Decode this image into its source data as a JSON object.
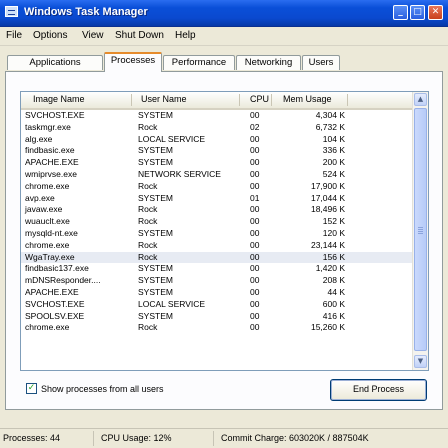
{
  "window": {
    "title": "Windows Task Manager"
  },
  "menu": [
    "File",
    "Options",
    "View",
    "Shut Down",
    "Help"
  ],
  "tabs": [
    {
      "label": "Applications",
      "active": false
    },
    {
      "label": "Processes",
      "active": true
    },
    {
      "label": "Performance",
      "active": false
    },
    {
      "label": "Networking",
      "active": false
    },
    {
      "label": "Users",
      "active": false
    }
  ],
  "columns": [
    "Image Name",
    "User Name",
    "CPU",
    "Mem Usage"
  ],
  "processes": [
    [
      "SVCHOST.EXE",
      "SYSTEM",
      "00",
      "4,304 K"
    ],
    [
      "taskmgr.exe",
      "Rock",
      "02",
      "6,732 K"
    ],
    [
      "alg.exe",
      "LOCAL SERVICE",
      "00",
      "104 K"
    ],
    [
      "findbasic.exe",
      "SYSTEM",
      "00",
      "336 K"
    ],
    [
      "APACHE.EXE",
      "SYSTEM",
      "00",
      "200 K"
    ],
    [
      "wmiprvse.exe",
      "NETWORK SERVICE",
      "00",
      "524 K"
    ],
    [
      "chrome.exe",
      "Rock",
      "00",
      "17,900 K"
    ],
    [
      "avp.exe",
      "SYSTEM",
      "01",
      "17,044 K"
    ],
    [
      "javaw.exe",
      "Rock",
      "00",
      "18,496 K"
    ],
    [
      "wuauclt.exe",
      "Rock",
      "00",
      "152 K"
    ],
    [
      "mysqld-nt.exe",
      "SYSTEM",
      "00",
      "120 K"
    ],
    [
      "chrome.exe",
      "Rock",
      "00",
      "23,144 K"
    ],
    [
      "WgaTray.exe",
      "Rock",
      "00",
      "156 K"
    ],
    [
      "findbasic137.exe",
      "SYSTEM",
      "00",
      "1,420 K"
    ],
    [
      "mDNSResponder....",
      "SYSTEM",
      "00",
      "208 K"
    ],
    [
      "APACHE.EXE",
      "SYSTEM",
      "00",
      "44 K"
    ],
    [
      "SVCHOST.EXE",
      "LOCAL SERVICE",
      "00",
      "600 K"
    ],
    [
      "SPOOLSV.EXE",
      "SYSTEM",
      "00",
      "416 K"
    ],
    [
      "chrome.exe",
      "Rock",
      "00",
      "15,260 K"
    ]
  ],
  "selected_row": 12,
  "show_all_users": {
    "label": "Show processes from all users",
    "checked": true
  },
  "end_process_label": "End Process",
  "status": {
    "processes": "Processes: 44",
    "cpu": "CPU Usage: 12%",
    "commit": "Commit Charge: 603020K / 887504K"
  },
  "icons": {
    "scroll_up": "▲",
    "scroll_down": "▼",
    "minimize": "_",
    "maximize": "□",
    "close": "✕",
    "check": "✓"
  }
}
